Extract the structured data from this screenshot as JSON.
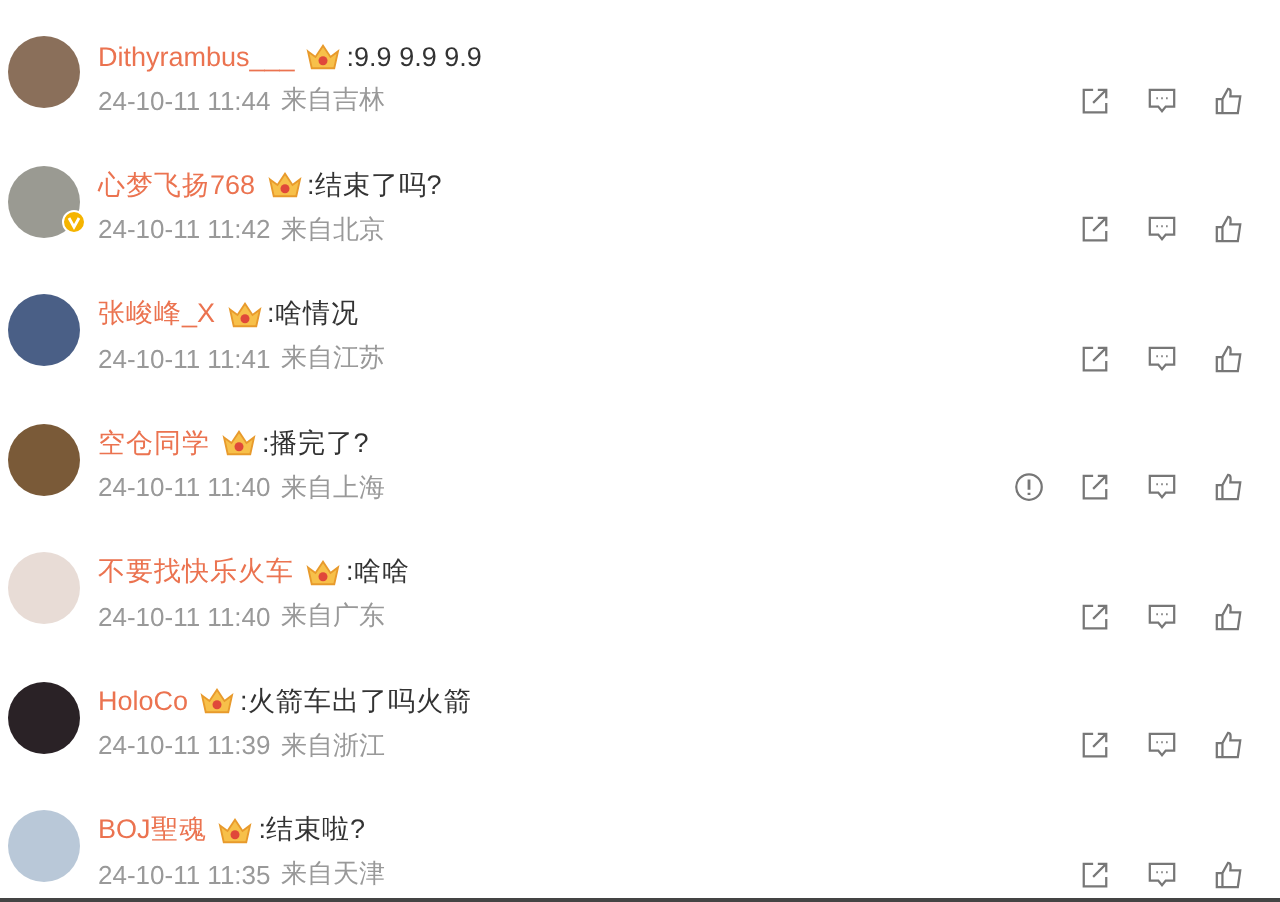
{
  "comments": [
    {
      "user": "Dithyrambus___",
      "verified": false,
      "text": ":9.9 9.9 9.9",
      "time": "24-10-11 11:44",
      "location": "来自吉林",
      "report_shown": false
    },
    {
      "user": "心梦飞扬768",
      "verified": true,
      "text": ":结束了吗?",
      "time": "24-10-11 11:42",
      "location": "来自北京",
      "report_shown": false
    },
    {
      "user": "张峻峰_X",
      "verified": false,
      "text": ":啥情况",
      "time": "24-10-11 11:41",
      "location": "来自江苏",
      "report_shown": false
    },
    {
      "user": "空仓同学",
      "verified": false,
      "text": ":播完了?",
      "time": "24-10-11 11:40",
      "location": "来自上海",
      "report_shown": true
    },
    {
      "user": "不要找快乐火车",
      "verified": false,
      "text": ":啥啥",
      "time": "24-10-11 11:40",
      "location": "来自广东",
      "report_shown": false
    },
    {
      "user": "HoloCo",
      "verified": false,
      "text": ":火箭车出了吗火箭",
      "time": "24-10-11 11:39",
      "location": "来自浙江",
      "report_shown": false
    },
    {
      "user": "BOJ聖魂",
      "verified": false,
      "text": ":结束啦?",
      "time": "24-10-11 11:35",
      "location": "来自天津",
      "report_shown": false
    }
  ]
}
